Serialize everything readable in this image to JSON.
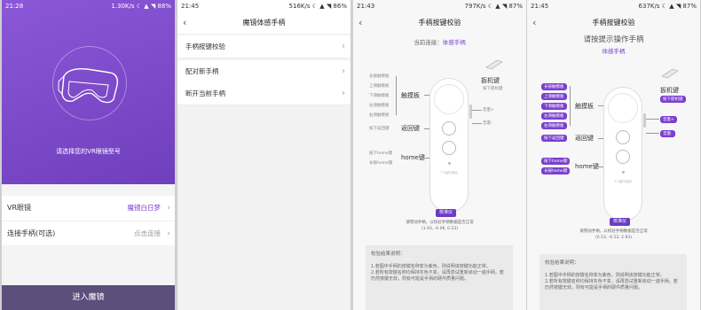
{
  "screen1": {
    "status": {
      "time": "21:28",
      "right": "1.30K/s ☾ ▲ ◥ 88%"
    },
    "prompt": "请选择您的VR眼镜型号",
    "rows": [
      {
        "label": "VR眼镜",
        "value": "魔镜白日梦",
        "value_color": "#7b3fd0"
      },
      {
        "label": "连接手柄(可选)",
        "value": "点击连接",
        "value_color": "#999999"
      }
    ],
    "enter_button": "进入魔镜"
  },
  "screen2": {
    "status": {
      "time": "21:45",
      "right": "516K/s ☾ ▲ ◥ 86%"
    },
    "title": "魔镜体感手柄",
    "rows": [
      "手柄按键校验",
      "配对新手柄",
      "断开当前手柄"
    ]
  },
  "screen3": {
    "status": {
      "time": "21:43",
      "right": "797K/s ☾ ▲ ◥ 87%"
    },
    "title": "手柄按键校验",
    "connected_label": "当前连接：",
    "connected_device": "体感手柄",
    "left_labels": [
      "长按触摸板",
      "上滑触摸板",
      "下滑触摸板",
      "左滑触摸板",
      "右滑触摸板"
    ],
    "touchpad": "触摸板",
    "press_back": "按下返回键",
    "back_key": "返回键",
    "press_home": "按下home键",
    "long_home": "长按home键",
    "home_key": "home键",
    "trigger": "扳机键",
    "press_trigger": "按下扳机键",
    "vol_up": "音量+",
    "vol_down": "音量-",
    "brand": "T-T运行自动",
    "calibrate": "校准仪",
    "hint": "请晃动手柄，以校验手柄数据是否正常",
    "readout": "(1.93, -0.06, 0.23)",
    "result_title": "校验结果说明：",
    "result_lines": [
      "1.若图中手柄的按键名称变为紫色，则说明该按键功能正常。",
      "2.若所有按键名称均保持灰色不变，请再尝试重新启动一遍手柄，若仍然按键无效，则有可能是手柄的硬件质量问题。"
    ]
  },
  "screen4": {
    "status": {
      "time": "21:45",
      "right": "637K/s ☾ ▲ ◥ 87%"
    },
    "title": "手柄按键校验",
    "prompt": "请按提示操作手柄",
    "connected_device": "体感手柄",
    "readout": "(0.53, -0.12, 2.93)"
  },
  "colors": {
    "accent": "#7b3fd0",
    "enter_bg": "#5c4f7c"
  }
}
